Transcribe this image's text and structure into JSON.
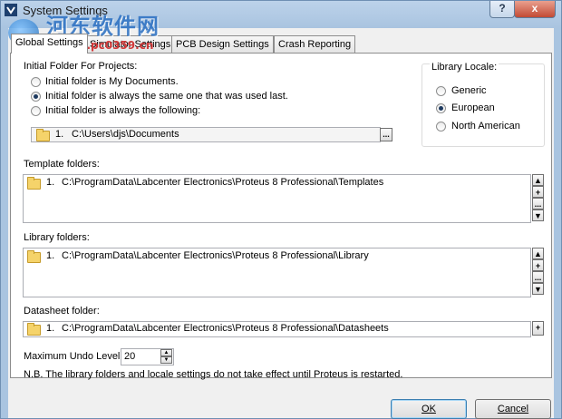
{
  "window": {
    "title": "System Settings",
    "help_label": "?",
    "close_label": "x"
  },
  "watermark": {
    "text": "河东软件网",
    "url": "www.pc0359.cn"
  },
  "tabs": [
    {
      "label": "Global Settings",
      "active": true
    },
    {
      "label": "Simulator Settings",
      "active": false
    },
    {
      "label": "PCB Design Settings",
      "active": false
    },
    {
      "label": "Crash Reporting",
      "active": false
    }
  ],
  "initial_folder": {
    "heading": "Initial Folder For Projects:",
    "options": [
      {
        "label": "Initial folder is My Documents.",
        "checked": false
      },
      {
        "label": "Initial folder is always the same one that was used last.",
        "checked": true
      },
      {
        "label": "Initial folder is always the following:",
        "checked": false
      }
    ],
    "path_index": "1.",
    "path_value": "C:\\Users\\djs\\Documents",
    "browse_label": "..."
  },
  "library_locale": {
    "heading": "Library Locale:",
    "options": [
      {
        "label": "Generic",
        "checked": false
      },
      {
        "label": "European",
        "checked": true
      },
      {
        "label": "North American",
        "checked": false
      }
    ]
  },
  "template_folders": {
    "heading": "Template folders:",
    "items": [
      {
        "index": "1.",
        "path": "C:\\ProgramData\\Labcenter Electronics\\Proteus 8 Professional\\Templates"
      }
    ]
  },
  "library_folders": {
    "heading": "Library folders:",
    "items": [
      {
        "index": "1.",
        "path": "C:\\ProgramData\\Labcenter Electronics\\Proteus 8 Professional\\Library"
      }
    ]
  },
  "datasheet_folder": {
    "heading": "Datasheet folder:",
    "index": "1.",
    "path": "C:\\ProgramData\\Labcenter Electronics\\Proteus 8 Professional\\Datasheets"
  },
  "list_buttons": {
    "up": "▲",
    "add": "+",
    "ellipsis": "...",
    "down": "▼"
  },
  "undo": {
    "label": "Maximum Undo Level",
    "value": "20"
  },
  "note": "N.B. The library folders and locale settings do not take effect until Proteus is restarted.",
  "buttons": {
    "ok": "OK",
    "cancel": "Cancel"
  }
}
